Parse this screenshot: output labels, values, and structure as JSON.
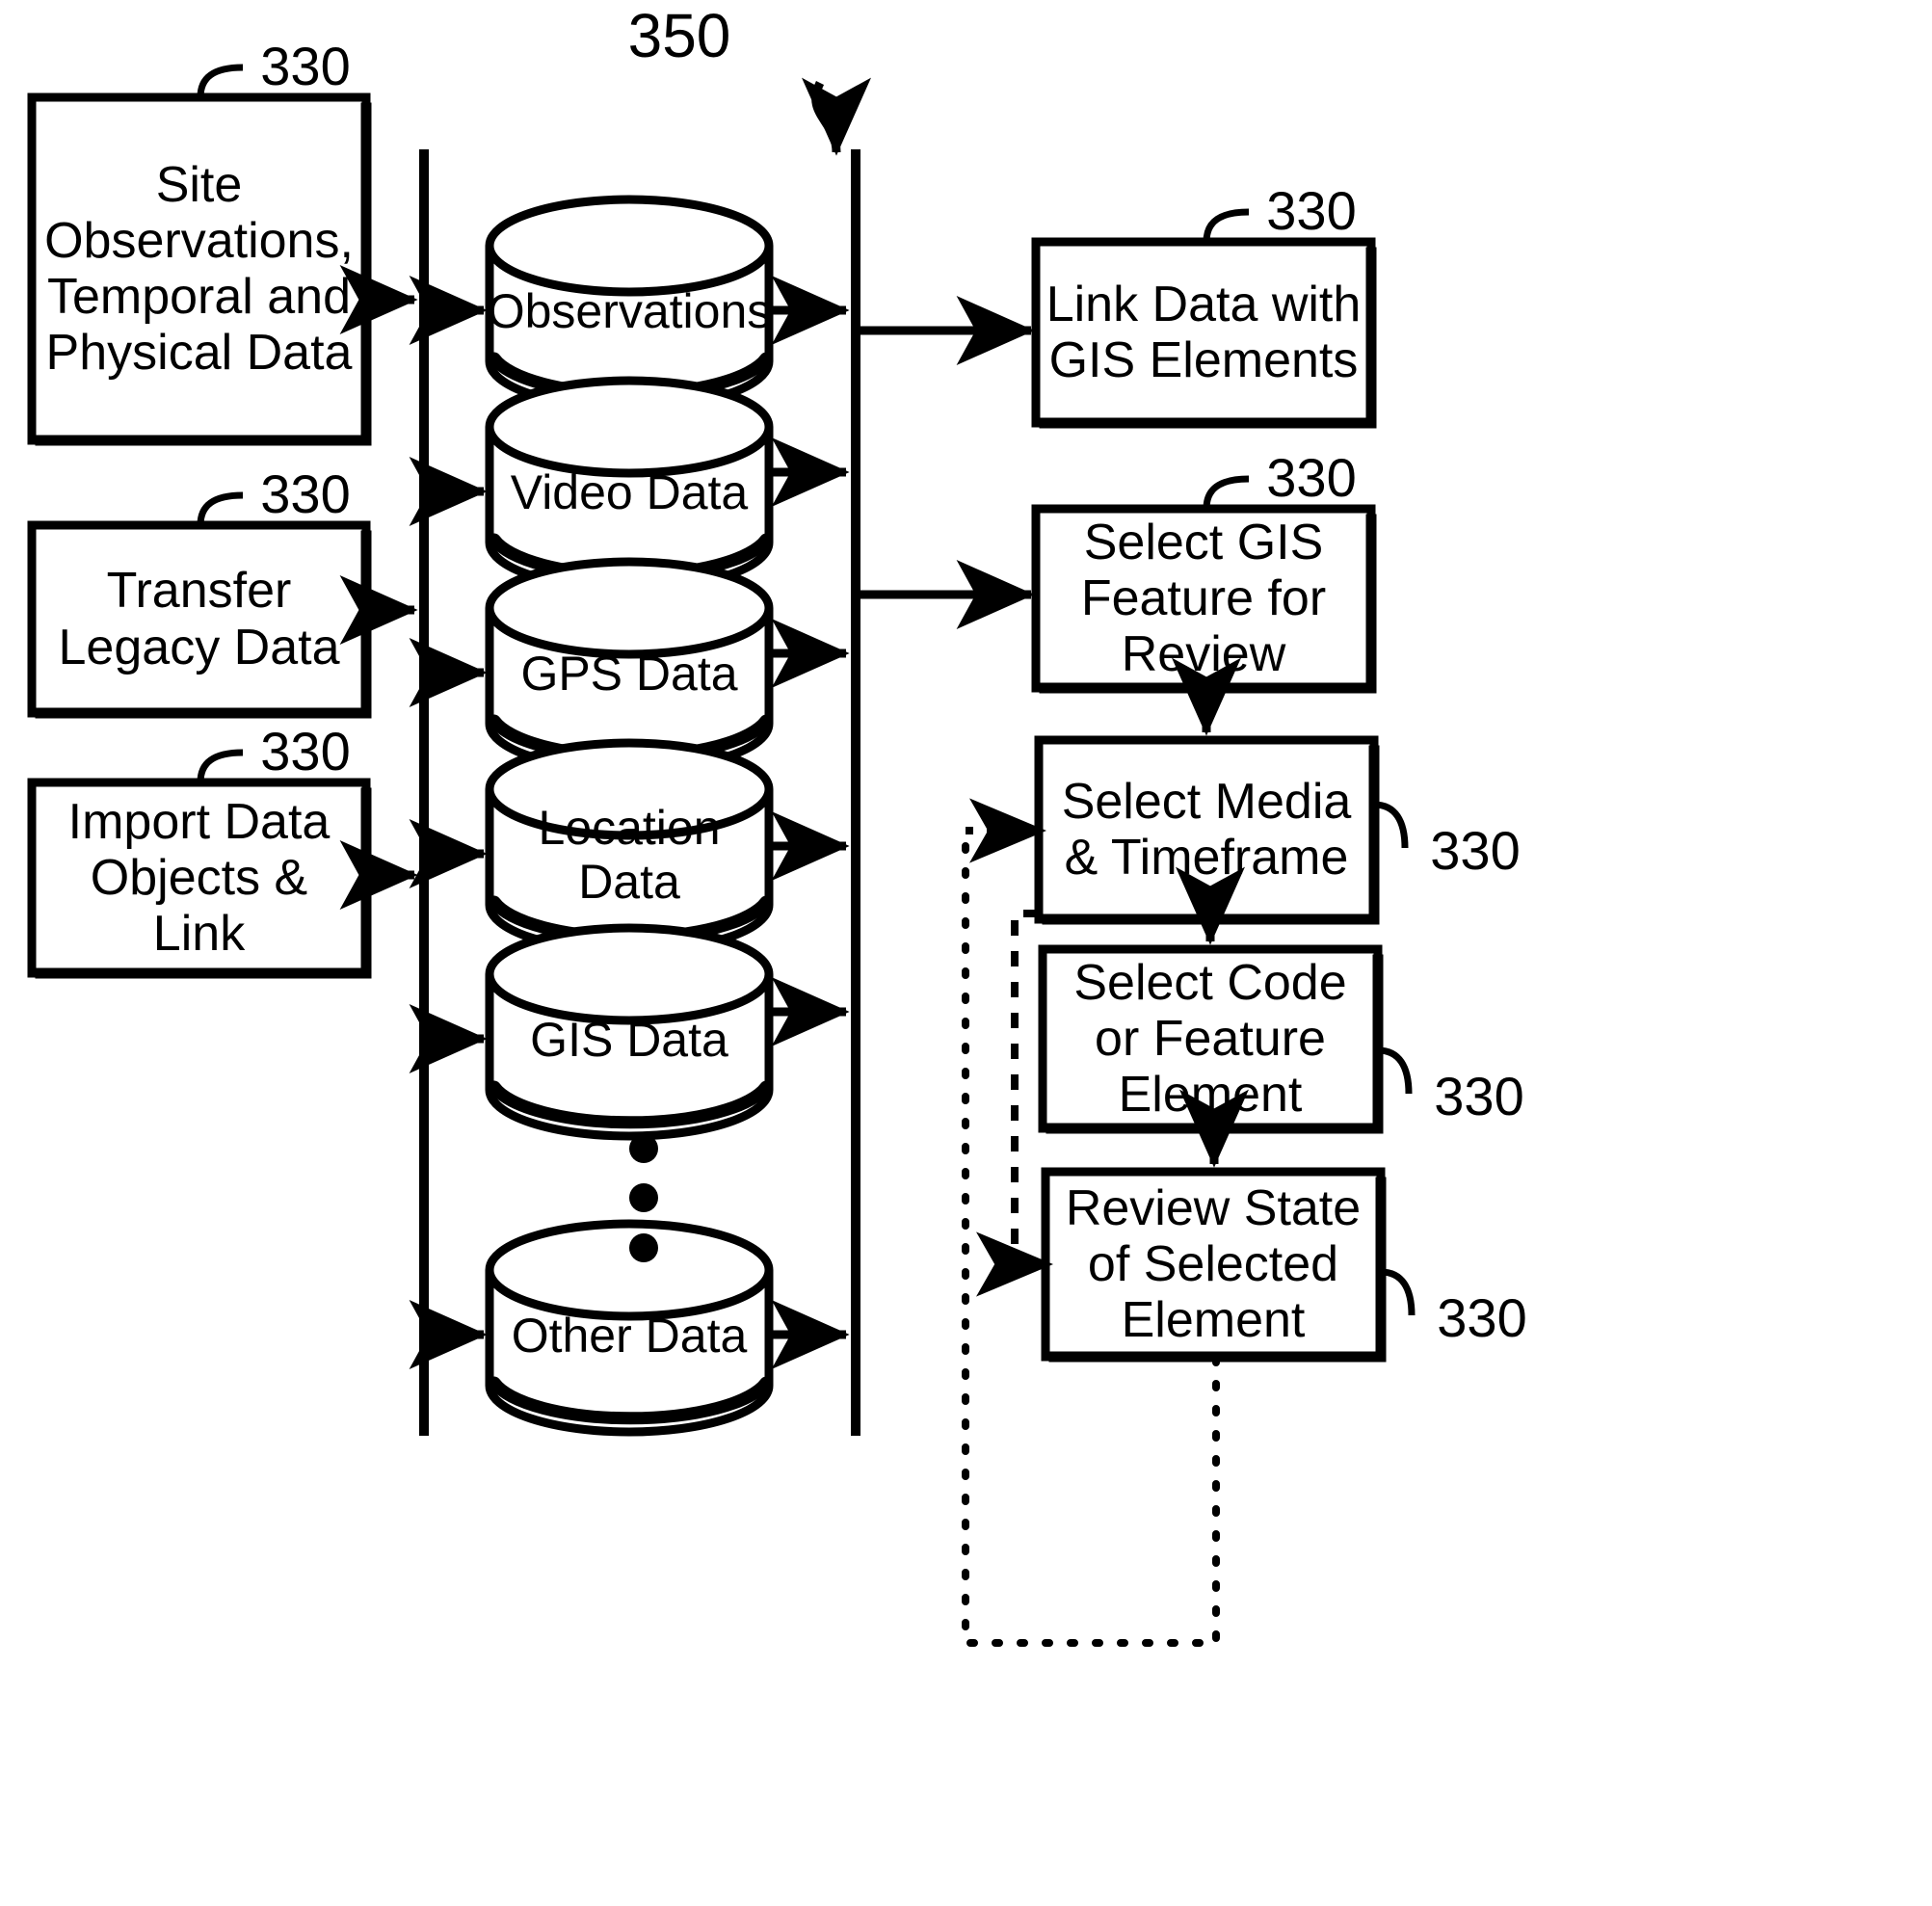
{
  "figure": {
    "number": "350",
    "reference_tag": "330"
  },
  "inputs": {
    "title": "input-process-boxes",
    "items": [
      {
        "label": "Site\nObservations,\nTemporal and\nPhysical Data",
        "ref": "330"
      },
      {
        "label": "Transfer\nLegacy Data",
        "ref": "330"
      },
      {
        "label": "Import Data\nObjects &\nLink",
        "ref": "330"
      }
    ]
  },
  "datastores": {
    "title": "database-cylinders",
    "items": [
      {
        "label": "Observations"
      },
      {
        "label": "Video Data"
      },
      {
        "label": "GPS Data"
      },
      {
        "label": "Location Data"
      },
      {
        "label": "GIS Data"
      },
      {
        "label": "Other Data"
      }
    ],
    "ellipsis": "• • •"
  },
  "outputs": {
    "title": "review-process-boxes",
    "items": [
      {
        "label": "Link Data with\nGIS Elements",
        "ref": "330"
      },
      {
        "label": "Select GIS\nFeature for\nReview",
        "ref": "330"
      },
      {
        "label": "Select Media\n& Timeframe",
        "ref": "330"
      },
      {
        "label": "Select Code\nor Feature\nElement",
        "ref": "330"
      },
      {
        "label": "Review State\nof Selected\nElement",
        "ref": "330"
      }
    ]
  },
  "colors": {
    "stroke": "#000000",
    "fill": "#ffffff",
    "background": "#ffffff"
  }
}
